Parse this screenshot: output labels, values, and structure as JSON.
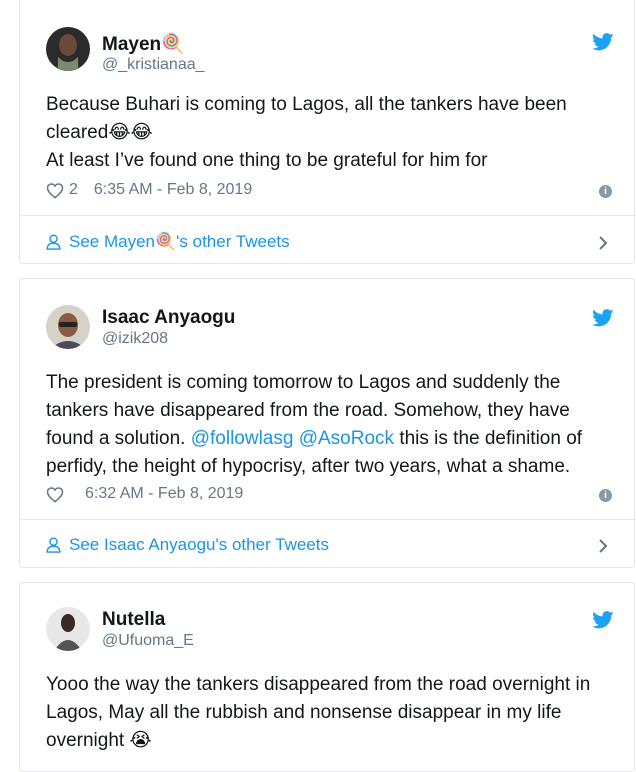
{
  "tweets": [
    {
      "name": "Mayen🍭",
      "handle": "@_kristianaa_",
      "lines": [
        "Because Buhari is coming to Lagos, all the tankers have been cleared😂😂",
        "At least I’ve found one thing to be grateful for him for"
      ],
      "likes": "2",
      "time": "6:35 AM - Feb 8, 2019",
      "see_link": "See Mayen🍭's other Tweets"
    },
    {
      "name": "Isaac Anyaogu",
      "handle": "@izik208",
      "text_before": "The president is coming tomorrow to Lagos and suddenly the tankers have disappeared from the road. Somehow, they have found a solution. ",
      "mention1": "@followlasg",
      "mention2": "@AsoRock",
      "text_after": " this is the definition of perfidy, the height of hypocrisy, after two years, what a shame.",
      "time": "6:32 AM - Feb 8, 2019",
      "see_link": "See Isaac Anyaogu's other Tweets"
    },
    {
      "name": "Nutella",
      "handle": "@Ufuoma_E",
      "text": "Yooo the way the tankers disappeared from the road overnight in Lagos, May all the rubbish and nonsense disappear in my life overnight 😭"
    }
  ],
  "colors": {
    "link": "#1b95e0",
    "secondary": "#657786",
    "border": "#e1e8ed",
    "twitter_blue": "#1da1f2"
  },
  "icons": [
    "twitter-bird-icon",
    "heart-icon",
    "info-icon",
    "person-icon",
    "chevron-right-icon"
  ]
}
